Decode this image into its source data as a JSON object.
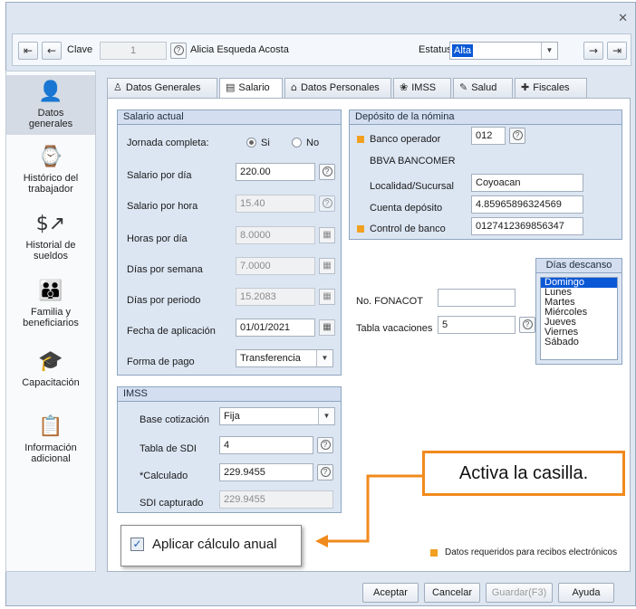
{
  "window": {
    "close_icon": "close-icon"
  },
  "toolbar": {
    "clave_label": "Clave",
    "clave_value": "1",
    "employee_name": "Alicia Esqueda Acosta",
    "estatus_label": "Estatus",
    "estatus_value": "Alta"
  },
  "sidebar": {
    "items": [
      {
        "label1": "Datos",
        "label2": "generales",
        "icon": "person-icon"
      },
      {
        "label1": "Histórico del",
        "label2": "trabajador",
        "icon": "history-icon"
      },
      {
        "label1": "Historial de",
        "label2": "sueldos",
        "icon": "salary-chart-icon"
      },
      {
        "label1": "Familia y",
        "label2": "beneficiarios",
        "icon": "family-icon"
      },
      {
        "label1": "Capacitación",
        "label2": "",
        "icon": "graduation-cap-icon"
      },
      {
        "label1": "Información",
        "label2": "adicional",
        "icon": "info-doc-icon"
      }
    ]
  },
  "tabs": [
    {
      "label": "Datos Generales",
      "icon": "person-icon"
    },
    {
      "label": "Salario",
      "icon": "money-icon"
    },
    {
      "label": "Datos Personales",
      "icon": "home-icon"
    },
    {
      "label": "IMSS",
      "icon": "imss-icon"
    },
    {
      "label": "Salud",
      "icon": "health-icon"
    },
    {
      "label": "Fiscales",
      "icon": "fiscal-icon"
    }
  ],
  "salario_actual": {
    "title": "Salario actual",
    "jornada_label": "Jornada completa:",
    "si_label": "Si",
    "no_label": "No",
    "salario_dia_label": "Salario por día",
    "salario_dia_value": "220.00",
    "salario_hora_label": "Salario por hora",
    "salario_hora_value": "15.40",
    "horas_dia_label": "Horas por día",
    "horas_dia_value": "8.0000",
    "dias_semana_label": "Días por semana",
    "dias_semana_value": "7.0000",
    "dias_periodo_label": "Días por periodo",
    "dias_periodo_value": "15.2083",
    "fecha_label": "Fecha de aplicación",
    "fecha_value": "01/01/2021",
    "forma_pago_label": "Forma de pago",
    "forma_pago_value": "Transferencia"
  },
  "imss": {
    "title": "IMSS",
    "base_label": "Base cotización",
    "base_value": "Fija",
    "tabla_sdi_label": "Tabla de SDI",
    "tabla_sdi_value": "4",
    "calculado_label": "*Calculado",
    "calculado_value": "229.9455",
    "sdi_capturado_label": "SDI capturado",
    "sdi_capturado_value": "229.9455"
  },
  "deposito": {
    "title": "Depósito de la nómina",
    "banco_label": "Banco operador",
    "banco_value": "012",
    "banco_name": "BBVA BANCOMER",
    "localidad_label": "Localidad/Sucursal",
    "localidad_value": "Coyoacan",
    "cuenta_label": "Cuenta depósito",
    "cuenta_value": "4.85965896324569",
    "control_label": "Control de banco",
    "control_value": "0127412369856347"
  },
  "dias_descanso": {
    "title": "Días descanso",
    "days": [
      "Domingo",
      "Lunes",
      "Martes",
      "Miércoles",
      "Jueves",
      "Viernes",
      "Sábado"
    ],
    "selected": "Domingo"
  },
  "fonacot_label": "No. FONACOT",
  "fonacot_value": "",
  "vacaciones_label": "Tabla vacaciones",
  "vacaciones_value": "5",
  "aplicar_label": "Aplicar cálculo anual",
  "aplicar_checked": true,
  "callout_text": "Activa la casilla.",
  "required_note": "Datos requeridos para recibos electrónicos",
  "colors": {
    "required": "#f2a020",
    "callout_border": "#f08a1c",
    "selection": "#0a58d6"
  },
  "footer": {
    "aceptar": "Aceptar",
    "cancelar": "Cancelar",
    "guardar": "Guardar(F3)",
    "ayuda": "Ayuda"
  }
}
